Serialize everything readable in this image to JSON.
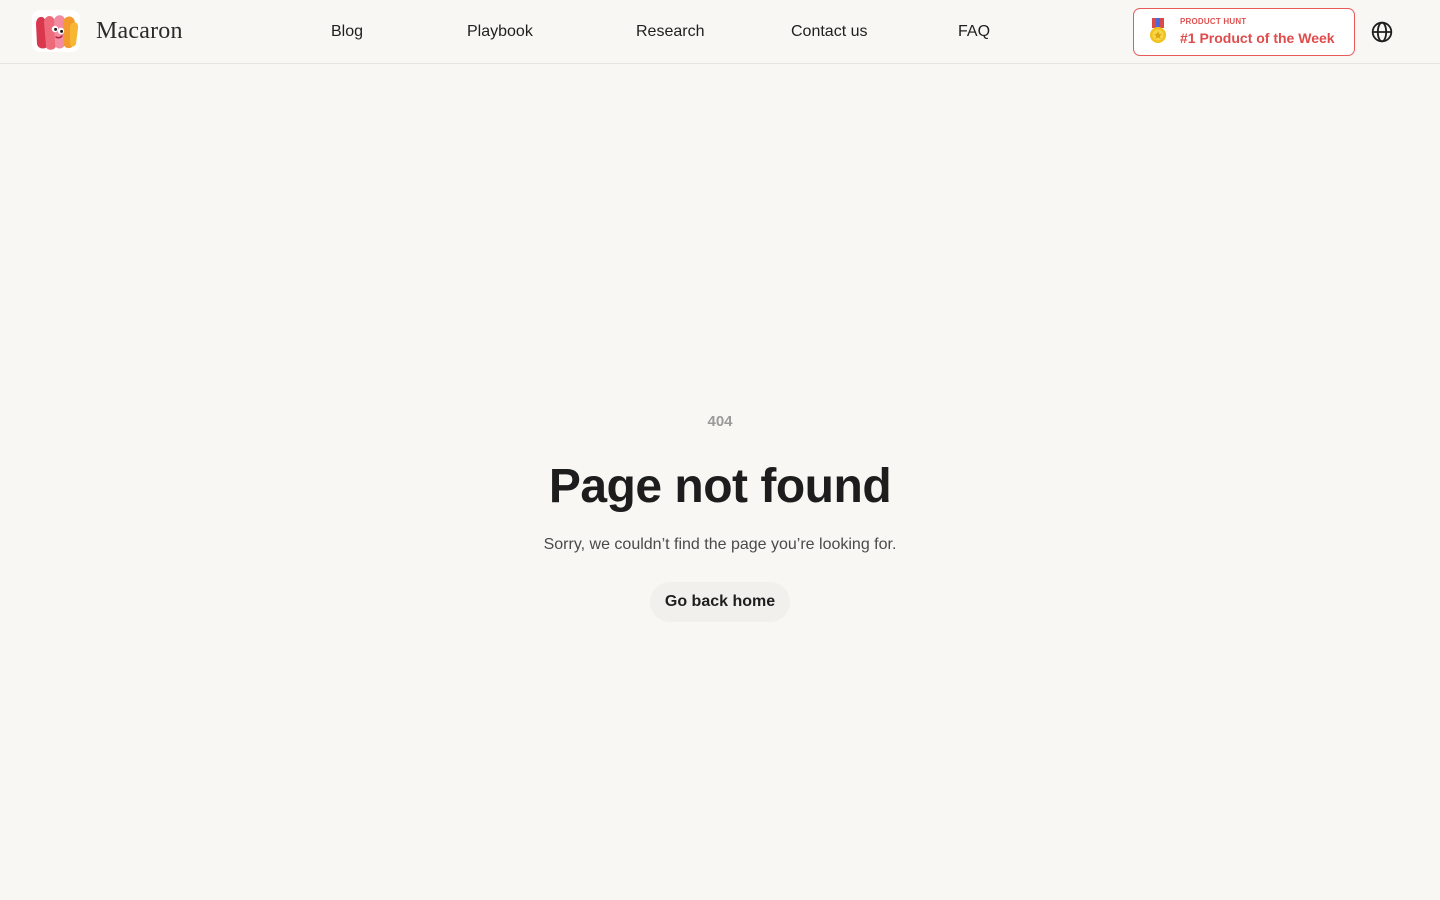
{
  "header": {
    "logo_text": "Macaron",
    "nav": [
      {
        "label": "Blog"
      },
      {
        "label": "Playbook"
      },
      {
        "label": "Research"
      },
      {
        "label": "Contact us"
      },
      {
        "label": "FAQ"
      }
    ],
    "product_hunt": {
      "kicker": "PRODUCT HUNT",
      "title": "#1 Product of the Week"
    },
    "language_icon": "globe-icon"
  },
  "main": {
    "code": "404",
    "title": "Page not found",
    "subtitle": "Sorry, we couldn’t find the page you’re looking for.",
    "button_label": "Go back home"
  },
  "colors": {
    "background": "#f8f7f3",
    "accent": "#e04c4c",
    "text": "#1f1f1f",
    "muted": "#9a9a9a"
  }
}
